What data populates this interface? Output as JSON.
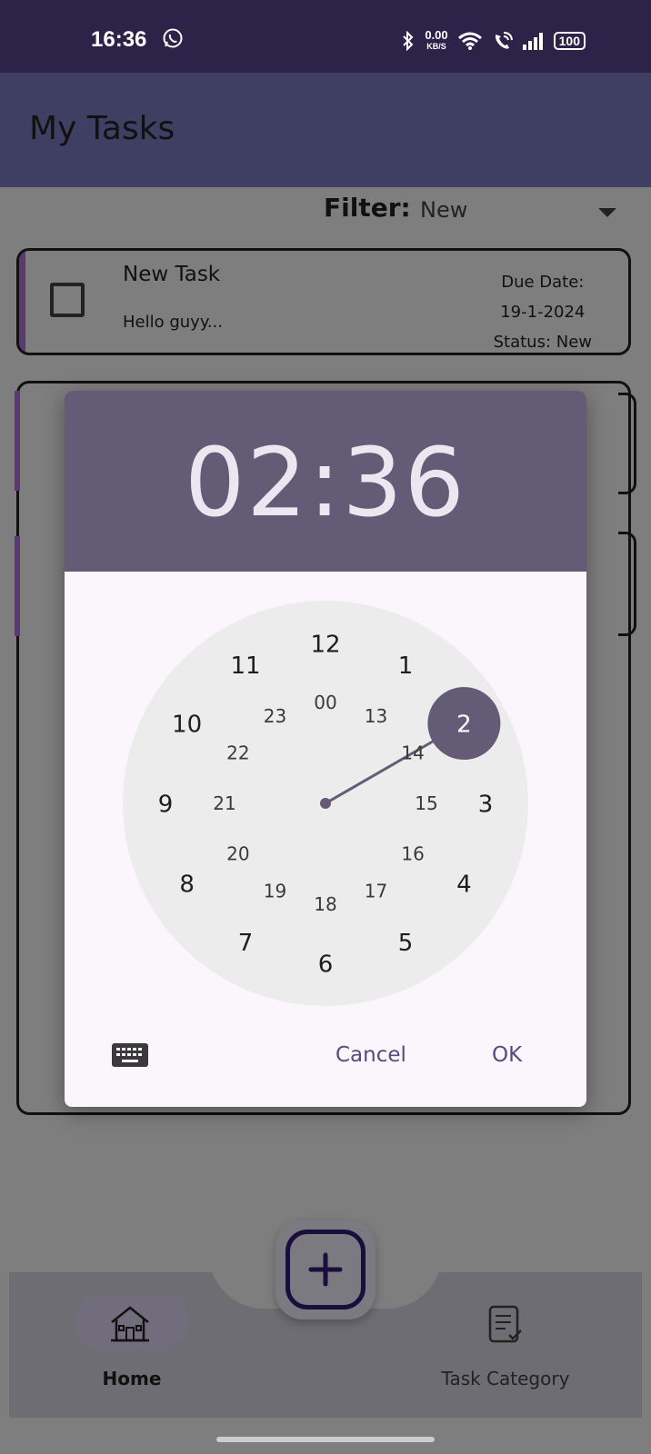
{
  "status_bar": {
    "time": "16:36",
    "net_speed_value": "0.00",
    "net_speed_unit": "KB/S",
    "battery": "100",
    "icons": [
      "whatsapp-icon",
      "bluetooth-icon",
      "wifi-icon",
      "wifi-calling-icon",
      "signal-icon",
      "battery-icon"
    ]
  },
  "app_bar": {
    "title": "My Tasks"
  },
  "filter": {
    "label": "Filter:",
    "selected": "New"
  },
  "task_card": {
    "title": "New Task",
    "description": "Hello guyy...",
    "due_label": "Due Date:",
    "due_date": "19-1-2024",
    "status": "Status: New"
  },
  "time_picker": {
    "time_display": "02:36",
    "outer_hours": [
      "12",
      "1",
      "2",
      "3",
      "4",
      "5",
      "6",
      "7",
      "8",
      "9",
      "10",
      "11"
    ],
    "inner_hours": [
      "00",
      "13",
      "14",
      "15",
      "16",
      "17",
      "18",
      "19",
      "20",
      "21",
      "22",
      "23"
    ],
    "selected_hour": "2",
    "cancel_label": "Cancel",
    "ok_label": "OK",
    "accent_color": "#645b76",
    "dial_color": "#ececec"
  },
  "bottom_nav": {
    "items": [
      {
        "label": "Home",
        "icon": "home-icon",
        "active": true
      },
      {
        "label": "Task Category",
        "icon": "checklist-icon",
        "active": false
      }
    ],
    "fab_icon": "plus-icon"
  }
}
